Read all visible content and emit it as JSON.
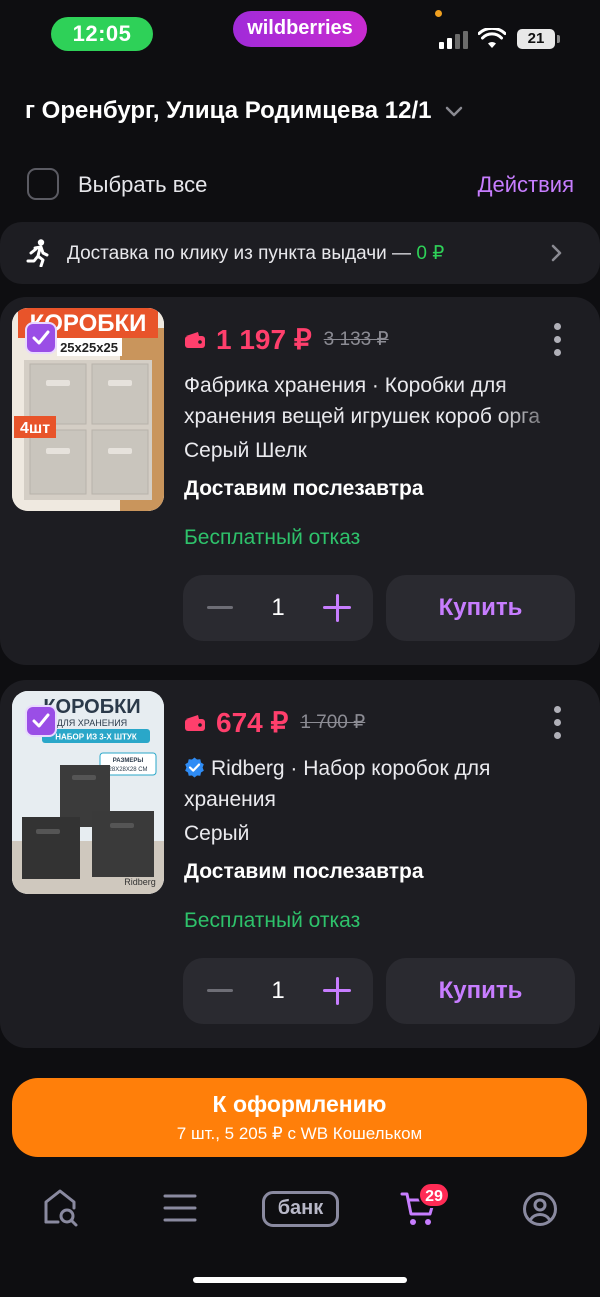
{
  "status_bar": {
    "time": "12:05",
    "brand": "wildberries",
    "battery": "21"
  },
  "address": {
    "text": "г Оренбург, Улица Родимцева 12/1"
  },
  "select_all": {
    "label": "Выбрать все",
    "actions": "Действия"
  },
  "delivery_banner": {
    "text": "Доставка по клику из пункта выдачи — ",
    "price": "0 ₽"
  },
  "items": [
    {
      "price": "1 197 ₽",
      "old_price": "3 133 ₽",
      "title": "Фабрика хранения · Коробки для хранения вещей игрушек короб орга",
      "variant": "Серый Шелк",
      "delivery": "Доставим послезавтра",
      "free_return": "Бесплатный отказ",
      "quantity": "1",
      "buy_label": "Купить",
      "thumb_title": "КОРОБКИ",
      "thumb_size": "25x25x25",
      "thumb_pcs": "4шт"
    },
    {
      "price": "674 ₽",
      "old_price": "1 700 ₽",
      "brand": "Ridberg",
      "title": "· Набор коробок для хранения",
      "variant": "Серый",
      "delivery": "Доставим послезавтра",
      "free_return": "Бесплатный отказ",
      "quantity": "1",
      "buy_label": "Купить",
      "thumb_title": "КОРОБКИ",
      "thumb_sub": "ДЛЯ ХРАНЕНИЯ",
      "thumb_set": "НАБОР ИЗ 3-Х ШТУК",
      "thumb_sizes": "РАЗМЕРЫ",
      "thumb_dims": "28X28X28 СМ",
      "thumb_brand": "Ridberg"
    }
  ],
  "checkout": {
    "title": "К оформлению",
    "subtitle": "7 шт., 5 205 ₽ с WB Кошельком"
  },
  "nav": {
    "bank_label": "банк",
    "cart_badge": "29"
  },
  "icons": [
    "home-search-icon",
    "catalog-menu-icon",
    "bank-icon",
    "cart-icon",
    "profile-icon"
  ],
  "colors": {
    "accent": "#c77dff",
    "price": "#ff3f6c",
    "success": "#2ec26b",
    "checkout": "#ff7f0a"
  }
}
